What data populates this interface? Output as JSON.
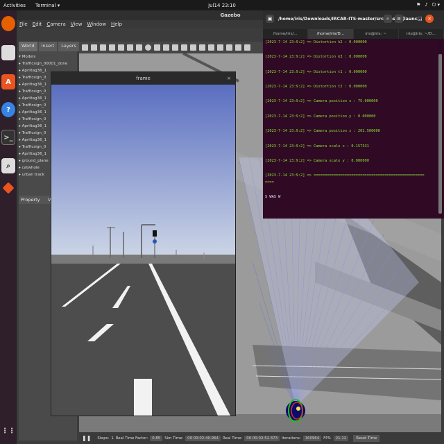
{
  "topbar": {
    "activities": "Activities",
    "app_menu": "Terminal ▾",
    "clock": "Jul14 23:10",
    "tray": [
      "⚑",
      "♪",
      "⏻ ▾"
    ]
  },
  "gazebo": {
    "title": "Gazebo",
    "menu": [
      "File",
      "Edit",
      "Camera",
      "View",
      "Window",
      "Help"
    ],
    "left_tabs": [
      "World",
      "Insert",
      "Layers"
    ],
    "tree": [
      "▾ Models",
      "▸ Trafficsign_00001_done",
      "▸ Apriltag36_1",
      "▸ Trafficsign_0",
      "▸ Apriltag36_1",
      "▸ Trafficsign_0",
      "▸ Apriltag36_1",
      "▸ Trafficsign_0",
      "▸ Apriltag36_1",
      "▸ Trafficsign_0",
      "▸ Apriltag36_1",
      "▸ Trafficsign_0",
      "▸ Apriltag36_1",
      "▸ Trafficsign_0",
      "▸ Apriltag36_1",
      "▸ ground_plane",
      "▸ catwhole",
      "▸ urban track"
    ],
    "property_header": "Property",
    "property_value": "V",
    "bottom": {
      "steps_label": "Steps:",
      "steps_value": "1",
      "rtf_label": "Real Time Factor:",
      "rtf_value": "0.85",
      "sim_label": "Sim Time:",
      "sim_value": "00 00:02:40.964",
      "real_label": "Real Time:",
      "real_value": "00 00:02:52.373",
      "iter_label": "Iterations:",
      "iter_value": "160964",
      "fps_label": "FPS:",
      "fps_value": "21.12",
      "reset": "Reset Time"
    }
  },
  "frame": {
    "title": "frame",
    "close": "×"
  },
  "terminal": {
    "title": "/home/iris/Downloads/IRCAR-ITS-master/src/master(launc...",
    "tabs": [
      "/home/iris/...",
      "/home/iris/D...",
      "iris@iris: ~",
      "iris@iris: ~/D..."
    ],
    "lines": [
      "[2023-7-14 23:9:2] => Distortion k2     : 0.000000",
      "[2023-7-14 23:9:2] => Distortion k3     : 0.000000",
      "[2023-7-14 23:9:2] => Distortion t1     : 0.000000",
      "[2023-7-14 23:9:2] => Distortion t2     : 0.000000",
      "[2023-7-14 23:9:2] => Camera position x  : 75.000000",
      "[2023-7-14 23:9:2] => Camera position y  : 0.000000",
      "[2023-7-14 23:9:2] => Camera position z  : 202.500000",
      "[2023-7-14 23:9:2] => Camera scale x     : 0.157331",
      "[2023-7-14 23:9:2] => Camera scale y     : 0.000000",
      "[2023-7-14 23:9:2] => ==================================================",
      "===="
    ],
    "prompt": "S WAS W"
  },
  "colors": {
    "terminal_bg": "#300a24",
    "terminal_text": "#8ae234",
    "dock_bg": "#2e1f2a",
    "accent": "#e95420"
  }
}
